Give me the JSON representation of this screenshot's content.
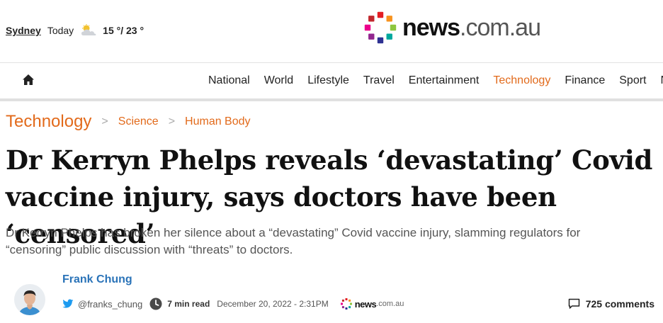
{
  "weather": {
    "city": "Sydney",
    "day": "Today",
    "icon": "partly-cloudy-icon",
    "temperature": "15 °/ 23 °"
  },
  "logo": {
    "word_bold": "news",
    "word_light": ".com.au",
    "dot_colors": [
      "#e31e24",
      "#f7931e",
      "#8dc63f",
      "#00a79d",
      "#2e3192",
      "#92278f",
      "#ec008c",
      "#c1272d"
    ]
  },
  "nav": {
    "home_icon": "home-icon",
    "items": [
      "National",
      "World",
      "Lifestyle",
      "Travel",
      "Entertainment",
      "Technology",
      "Finance",
      "Sport",
      "N"
    ],
    "active": "Technology",
    "active_color": "#e26a1b"
  },
  "breadcrumb": {
    "section": "Technology",
    "items": [
      "Science",
      "Human Body"
    ],
    "separator": ">"
  },
  "article": {
    "headline": "Dr Kerryn Phelps reveals ‘devastating’ Covid vaccine injury, says doctors have been ‘censored’",
    "standfirst": "Dr Kerryn Phelps has broken her silence about a “devastating” Covid vaccine injury, slamming regulators for “censoring” public discussion with “threats” to doctors."
  },
  "byline": {
    "author": "Frank Chung",
    "twitter_handle": "@franks_chung",
    "read_time": "7 min read",
    "date": "December 20, 2022 - 2:31PM",
    "source_bold": "news",
    "source_light": ".com.au",
    "author_color": "#2a73b8"
  },
  "comments": {
    "label": "725 comments",
    "icon": "comment-icon"
  }
}
